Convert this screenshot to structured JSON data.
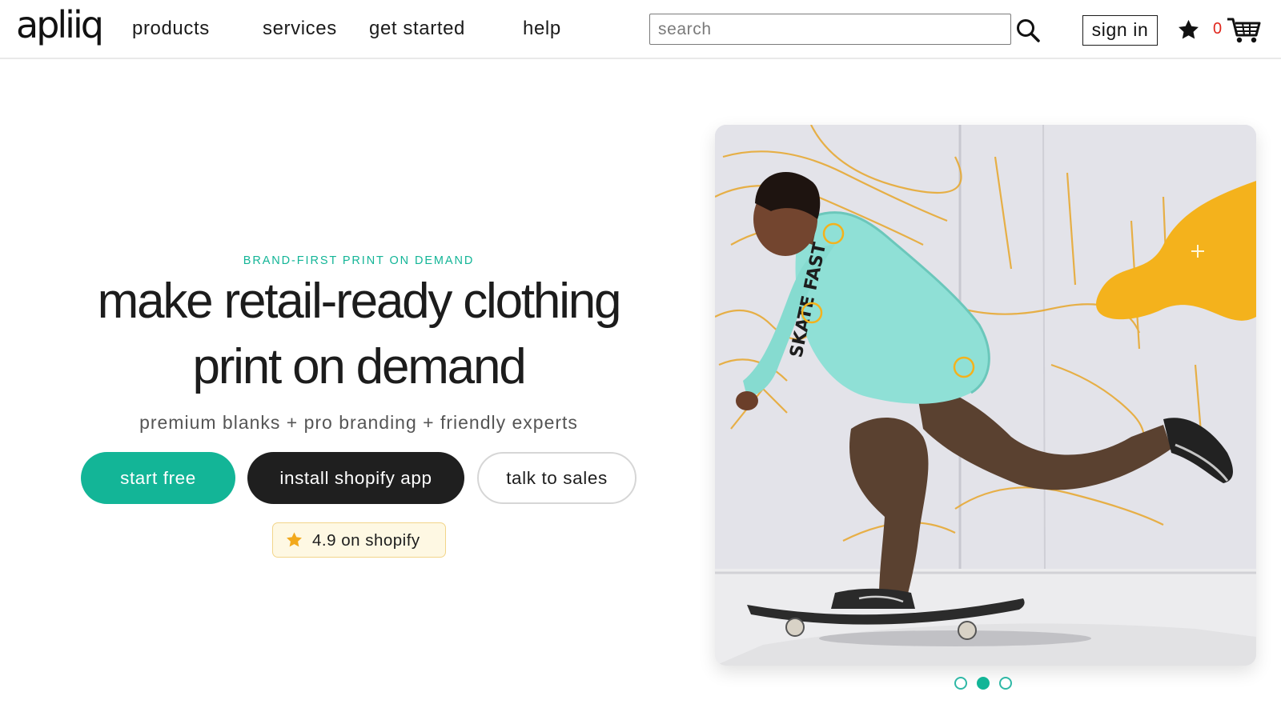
{
  "brand": {
    "name": "apliiq"
  },
  "nav": {
    "products": "products",
    "services": "services",
    "get_started": "get started",
    "help": "help"
  },
  "search": {
    "placeholder": "search",
    "value": "",
    "icon": "magnifier-icon"
  },
  "account": {
    "sign_in": "sign in",
    "favorites_icon": "star-icon",
    "cart_count": "0",
    "cart_icon": "shopping-cart-icon"
  },
  "hero": {
    "eyebrow": "BRAND-FIRST PRINT ON DEMAND",
    "headline_line1": "make retail-ready clothing",
    "headline_line2": "print on demand",
    "subline": "premium blanks + pro branding + friendly experts",
    "buttons": {
      "start_free": "start free",
      "install_shopify": "install shopify app",
      "talk_to_sales": "talk to sales"
    },
    "rating": {
      "text": "4.9 on shopify",
      "icon": "star-icon"
    }
  },
  "slider": {
    "count": 3,
    "active_index": 1
  },
  "photo": {
    "sleeve_print": "SKATE FAST"
  },
  "colors": {
    "accent": "#13b597",
    "dark_button": "#1f1f1f",
    "cart_count": "#e0261c",
    "rating_bg": "#fef8e3",
    "mural_yellow": "#f4b21c"
  }
}
